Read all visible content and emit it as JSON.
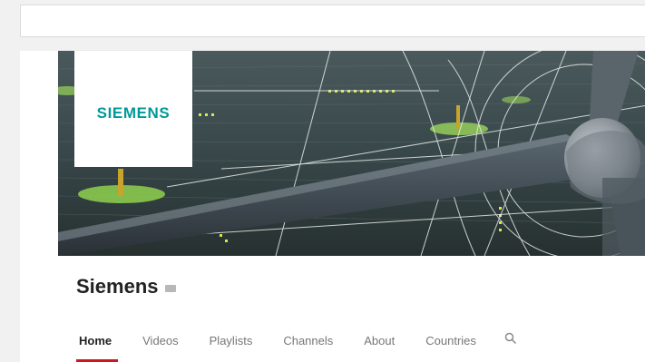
{
  "search_bar": {
    "value": ""
  },
  "banner": {
    "logo_text": "SIEMENS"
  },
  "channel": {
    "title": "Siemens",
    "verified_icon": "verified-badge-icon"
  },
  "tabs": [
    {
      "label": "Home",
      "active": true
    },
    {
      "label": "Videos",
      "active": false
    },
    {
      "label": "Playlists",
      "active": false
    },
    {
      "label": "Channels",
      "active": false
    },
    {
      "label": "About",
      "active": false
    },
    {
      "label": "Countries",
      "active": false
    }
  ],
  "tab_search_icon": "search-icon",
  "colors": {
    "accent": "#cc181e",
    "logo": "#009999",
    "background": "#f1f1f1"
  }
}
